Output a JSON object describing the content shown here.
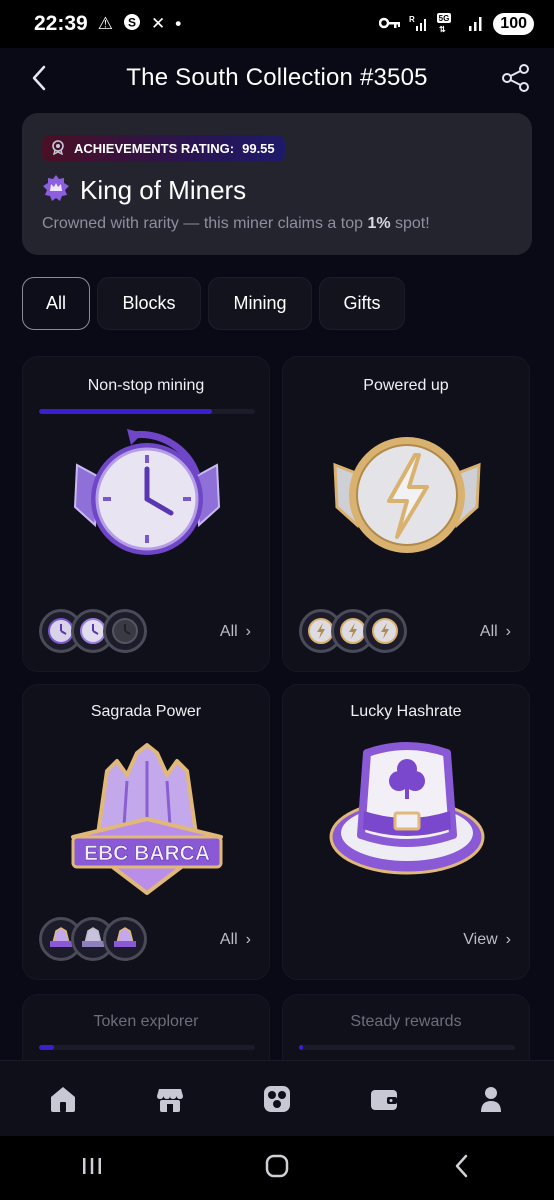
{
  "status_bar": {
    "time": "22:39",
    "left_icons": [
      "warning-icon",
      "dollar-circle-icon",
      "x-icon",
      "dot-icon"
    ],
    "right_icons": [
      "key-icon",
      "signal-r-icon",
      "signal-5g-icon",
      "signal-icon"
    ],
    "battery": "100"
  },
  "header": {
    "title": "The South Collection #3505"
  },
  "achievement": {
    "rating_label": "ACHIEVEMENTS RATING:",
    "rating_value": "99.55",
    "title": "King of Miners",
    "subtitle_prefix": "Crowned with rarity — this miner claims a top ",
    "subtitle_highlight": "1%",
    "subtitle_suffix": " spot!"
  },
  "tabs": [
    "All",
    "Blocks",
    "Mining",
    "Gifts"
  ],
  "active_tab": "All",
  "cards": [
    {
      "title": "Non-stop mining",
      "progress": 0.8,
      "medal": "clock-medal-icon",
      "action": "All"
    },
    {
      "title": "Powered up",
      "progress": 0,
      "medal": "lightning-medal-icon",
      "action": "All"
    },
    {
      "title": "Sagrada Power",
      "medal": "ebc-barca-badge-icon",
      "medal_text": "EBC BARCA",
      "action": "All"
    },
    {
      "title": "Lucky Hashrate",
      "medal": "clover-hat-badge-icon",
      "action": "View"
    },
    {
      "title": "Token explorer",
      "progress": 0.07
    },
    {
      "title": "Steady rewards",
      "progress": 0.02
    }
  ],
  "bottom_nav": [
    "home-icon",
    "store-icon",
    "mining-icon",
    "wallet-icon",
    "profile-icon"
  ],
  "system_nav": [
    "recents-icon",
    "home-circle-icon",
    "back-icon"
  ],
  "colors": {
    "background": "#0a0a17",
    "accent": "#3b1fcf",
    "medal_purple": "#7b4fd0",
    "card": "#10101b"
  }
}
